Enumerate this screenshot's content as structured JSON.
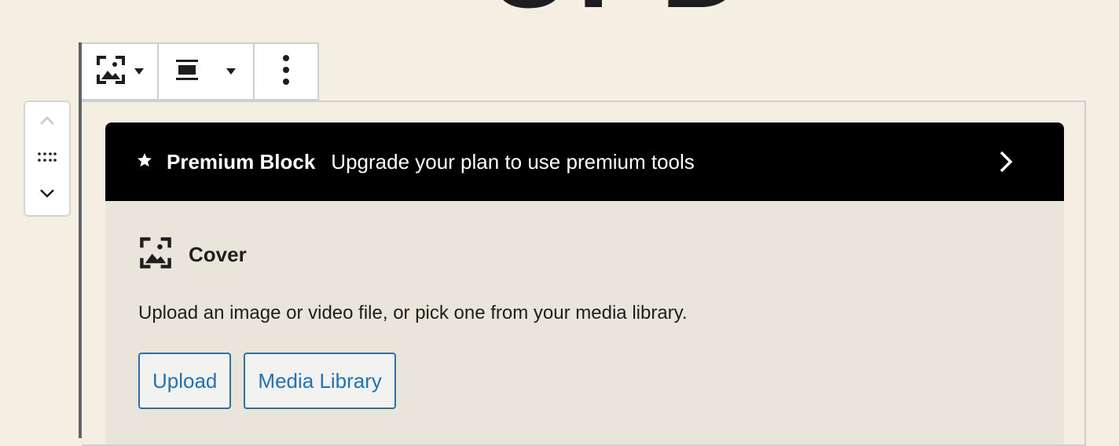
{
  "page_heading_fragment": "UPD",
  "block_toolbar": {
    "block_type_icon": "cover-icon",
    "align_icon": "align-wide-icon",
    "more_icon": "more-vertical-icon"
  },
  "block_mover": {
    "up_icon": "chevron-up-icon",
    "drag_icon": "drag-handle-icon",
    "down_icon": "chevron-down-icon"
  },
  "premium_banner": {
    "title": "Premium Block",
    "description": "Upgrade your plan to use premium tools"
  },
  "placeholder": {
    "title": "Cover",
    "instructions": "Upload an image or video file, or pick one from your media library.",
    "upload_label": "Upload",
    "media_library_label": "Media Library"
  },
  "colors": {
    "background": "#f5eee3",
    "banner": "#000000",
    "placeholder_bg": "#e9e5da",
    "accent": "#2271b1"
  }
}
